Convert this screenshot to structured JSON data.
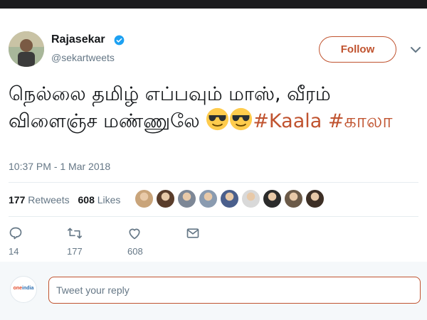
{
  "tweet": {
    "author_name": "Rajasekar",
    "author_handle": "@sekartweets",
    "follow_label": "Follow",
    "text_part1": "நெல்லை தமிழ் எப்பவும் மாஸ், வீரம் விளைஞ்ச மண்ணுலே ",
    "hashtag1": "#Kaala",
    "hashtag2": "#காலா",
    "emoji": "smiling-face-with-sunglasses",
    "timestamp": "10:37 PM - 1 Mar 2018"
  },
  "stats": {
    "retweets_count": "177",
    "retweets_label": "Retweets",
    "likes_count": "608",
    "likes_label": "Likes",
    "liker_colors": [
      "#c9a47a",
      "#5a3d2b",
      "#7d8796",
      "#8a9bb0",
      "#4a5f8c",
      "#d9d9d9",
      "#2b2b2b",
      "#6b5a48",
      "#3d2f25"
    ]
  },
  "actions": {
    "reply_count": "14",
    "retweet_count": "177",
    "like_count": "608"
  },
  "reply": {
    "placeholder": "Tweet your reply",
    "logo_text_a": "one",
    "logo_text_b": "india"
  },
  "colors": {
    "accent": "#c0532f",
    "verified": "#1da1f2",
    "muted": "#657786"
  }
}
